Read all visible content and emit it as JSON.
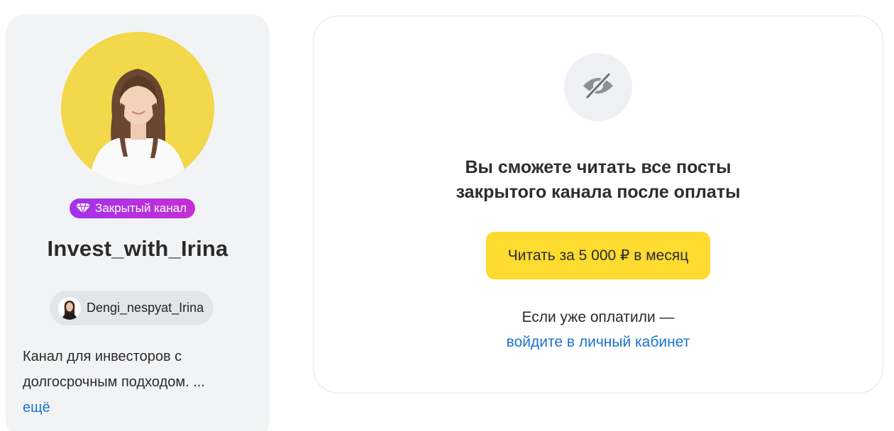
{
  "colors": {
    "accent_yellow": "#fedb2f",
    "badge_purple": "#b030e0",
    "link_blue": "#1a73cf",
    "card_gray": "#f2f3f5"
  },
  "channel": {
    "avatar_icon": "channel-avatar-photo",
    "badge_icon": "diamond-icon",
    "badge_label": "Закрытый канал",
    "title": "Invest_with_Irina",
    "author_icon": "author-avatar-photo",
    "author_name": "Dengi_nespyat_Irina",
    "description": "Канал для инвесторов с долгосрочным подходом. ...",
    "more_label": "ещё"
  },
  "paywall": {
    "icon": "eye-off-icon",
    "message_line1": "Вы сможете читать все посты",
    "message_line2": "закрытого канала после оплаты",
    "button_label": "Читать за 5 000 ₽ в месяц",
    "paid_note": "Если уже оплатили —",
    "login_link": "войдите в личный кабинет"
  }
}
